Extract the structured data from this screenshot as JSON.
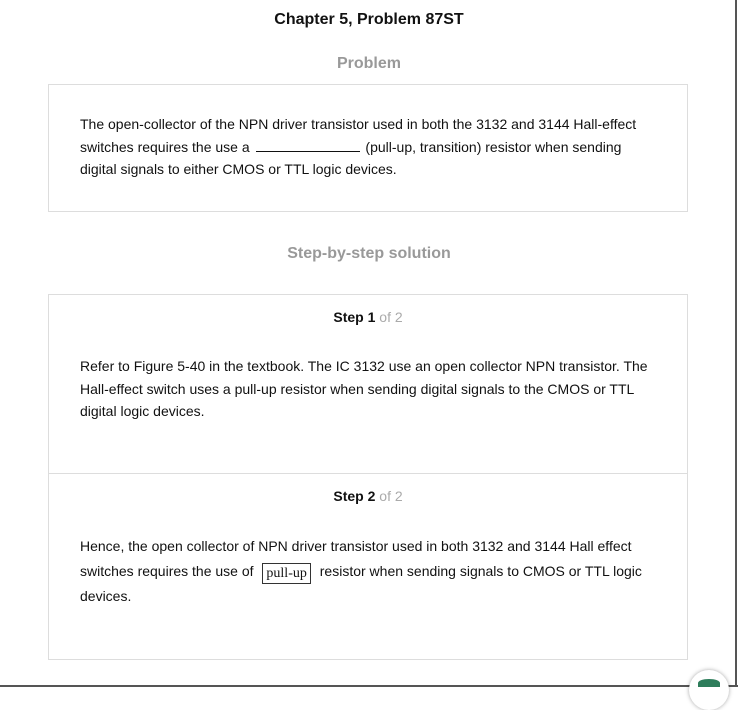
{
  "header": {
    "title": "Chapter 5, Problem 87ST"
  },
  "problem": {
    "heading": "Problem",
    "text_before_blank": "The open-collector of the NPN driver transistor used in both the 3132 and 3144 Hall-effect switches requires the use a",
    "text_after_blank": "(pull-up, transition) resistor when sending digital signals to either CMOS or TTL logic devices."
  },
  "solution": {
    "heading": "Step-by-step solution",
    "steps": [
      {
        "label": "Step",
        "number": "1",
        "of": "of 2",
        "text": "Refer to Figure 5-40 in the textbook. The IC 3132 use an open collector NPN transistor. The Hall-effect switch uses a pull-up resistor when sending digital signals to the CMOS or TTL digital logic devices."
      },
      {
        "label": "Step",
        "number": "2",
        "of": "of 2",
        "text_before": "Hence, the open collector of NPN driver transistor used in both 3132 and 3144 Hall effect switches requires the use of",
        "answer": "pull-up",
        "text_after": "resistor when sending signals to CMOS or TTL logic devices."
      }
    ]
  },
  "icons": {
    "chat": "chat-bubble-icon"
  },
  "colors": {
    "heading_gray": "#999999",
    "border": "#dddddd",
    "chat_green": "#2e7d5b"
  }
}
